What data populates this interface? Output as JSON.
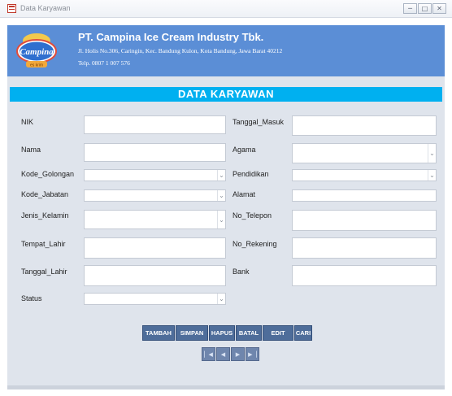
{
  "window": {
    "title": "Data Karyawan",
    "controls": [
      "─",
      "□",
      "✕"
    ]
  },
  "company": {
    "logo_text": "Campina",
    "logo_subtext": "es krim",
    "name": "PT. Campina Ice Cream Industry Tbk.",
    "address": "Jl. Holis No.306, Caringin, Kec. Bandung Kulon, Kota Bandung, Jawa Barat 40212",
    "phone": "Telp. 0807 1 007 576"
  },
  "form": {
    "title": "DATA KARYAWAN",
    "fields": {
      "nik": {
        "label": "NIK",
        "value": ""
      },
      "nama": {
        "label": "Nama",
        "value": ""
      },
      "kode_golongan": {
        "label": "Kode_Golongan",
        "value": ""
      },
      "kode_jabatan": {
        "label": "Kode_Jabatan",
        "value": ""
      },
      "jenis_kelamin": {
        "label": "Jenis_Kelamin",
        "value": ""
      },
      "tempat_lahir": {
        "label": "Tempat_Lahir",
        "value": ""
      },
      "tanggal_lahir": {
        "label": "Tanggal_Lahir",
        "value": ""
      },
      "status": {
        "label": "Status",
        "value": ""
      },
      "tanggal_masuk": {
        "label": "Tanggal_Masuk",
        "value": ""
      },
      "agama": {
        "label": "Agama",
        "value": ""
      },
      "pendidikan": {
        "label": "Pendidikan",
        "value": ""
      },
      "alamat": {
        "label": "Alamat",
        "value": ""
      },
      "no_telepon": {
        "label": "No_Telepon",
        "value": ""
      },
      "no_rekening": {
        "label": "No_Rekening",
        "value": ""
      },
      "bank": {
        "label": "Bank",
        "value": ""
      }
    }
  },
  "buttons": {
    "tambah": "TAMBAH",
    "simpan": "SIMPAN",
    "hapus": "HAPUS",
    "batal": "BATAL",
    "edit": "EDIT",
    "cari": "CARI"
  },
  "navigation": {
    "first": "▏◀",
    "prev": "◀",
    "next": "▶",
    "last": "▶▕"
  },
  "icons": {
    "combo": "chevron-down-icon"
  },
  "colors": {
    "header": "#5b8ed6",
    "title_bar": "#00b0f0",
    "button": "#4e6d9a",
    "background": "#dfe4ec"
  }
}
